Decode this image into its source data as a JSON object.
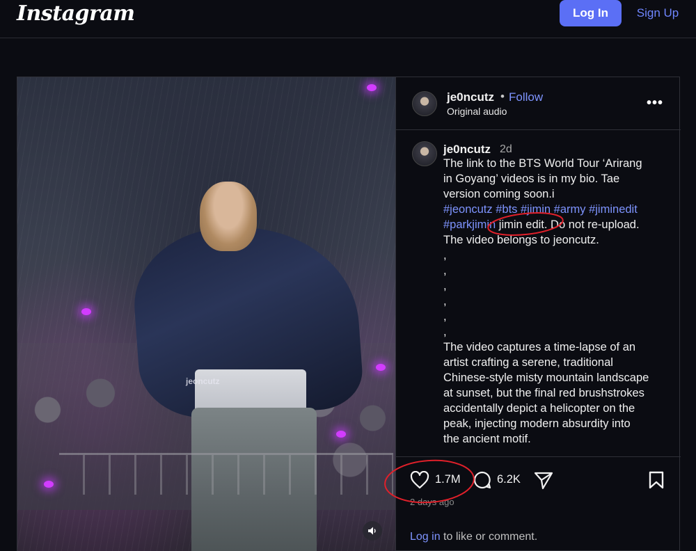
{
  "header": {
    "logo_text": "Instagram",
    "login_label": "Log In",
    "signup_label": "Sign Up"
  },
  "media": {
    "watermark": "jeoncutz",
    "sound_icon": "speaker-icon"
  },
  "post": {
    "username": "je0ncutz",
    "follow_label": "Follow",
    "separator": "•",
    "audio_label": "Original audio",
    "more_icon": "more-options-icon",
    "more_glyph": "•••",
    "caption": {
      "username": "je0ncutz",
      "time_ago": "2d",
      "lines": [
        "The link to the BTS World Tour ‘Arirang",
        "in Goyang’ videos is in my bio. Tae",
        "version coming soon.i"
      ],
      "hashtags_line1": "#jeoncutz #bts #jimin #army #jiminedit",
      "hashtags_line2": "#parkjimin",
      "after_tags": " jimin edit. Do not re-upload.",
      "line_after": "The video belongs to jeoncutz.",
      "commas": [
        ",",
        ",",
        ",",
        ",",
        ",",
        ","
      ],
      "description": [
        "The video captures a time-lapse of an",
        "artist crafting a serene, traditional",
        "Chinese-style misty mountain landscape",
        "at sunset, but the final red brushstrokes",
        "accidentally depict a helicopter on the",
        "peak, injecting modern absurdity into",
        "the ancient motif."
      ]
    },
    "likes": "1.7M",
    "comments": "6.2K",
    "date": "2 days ago",
    "login_link": "Log in",
    "login_rest": " to like or comment."
  },
  "colors": {
    "accent": "#5b6ff5",
    "link": "#7e94ff",
    "annotation": "#e0202a",
    "background": "#0b0c12"
  }
}
